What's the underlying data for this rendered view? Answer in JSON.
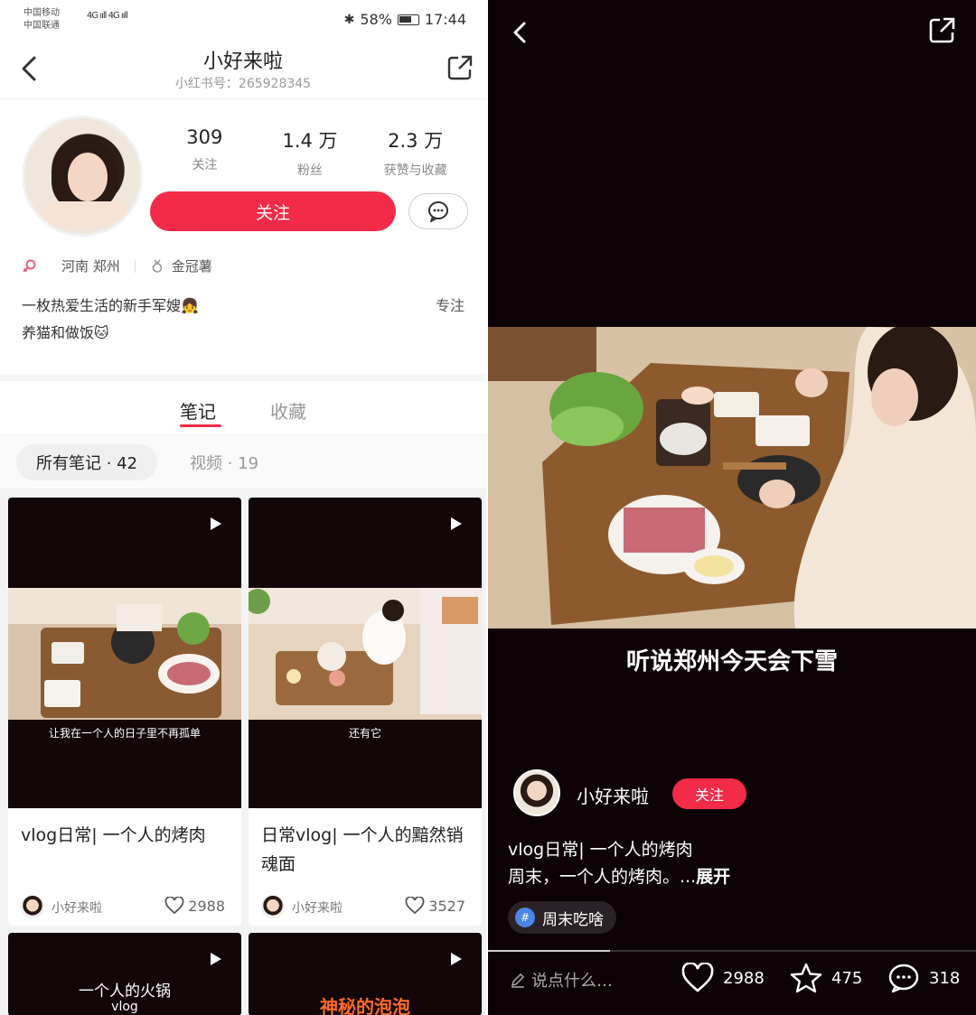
{
  "status_bar": {
    "carrier1": "中国移动",
    "carrier2": "中国联通",
    "signal": "4G ııll 4G ııll",
    "battery": "58%",
    "time": "17:44"
  },
  "profile_nav": {
    "title": "小好来啦",
    "subtitle": "小红书号：265928345"
  },
  "profile": {
    "stats": [
      {
        "value": "309",
        "label": "关注"
      },
      {
        "value": "1.4 万",
        "label": "粉丝"
      },
      {
        "value": "2.3 万",
        "label": "获赞与收藏"
      }
    ],
    "follow_label": "关注",
    "location": "河南 郑州",
    "badge": "金冠薯",
    "bio_line1": "一枚热爱生活的新手军嫂👧",
    "bio_line2": "养猫和做饭🐱",
    "focus": "专注"
  },
  "tabs": [
    {
      "label": "笔记",
      "active": true
    },
    {
      "label": "收藏",
      "active": false
    }
  ],
  "filters": {
    "all": "所有笔记 · 42",
    "video": "视频 · 19"
  },
  "notes": [
    {
      "subtitle": "让我在一个人的日子里不再孤单",
      "title": "vlog日常| 一个人的烤肉",
      "author": "小好来啦",
      "likes": "2988"
    },
    {
      "subtitle": "还有它",
      "title": "日常vlog| 一个人的黯然销魂面",
      "author": "小好来啦",
      "likes": "3527"
    },
    {
      "overlay": "一个人的火锅",
      "overlay_sub": "vlog"
    },
    {
      "overlay": "神秘的泡泡"
    }
  ],
  "video": {
    "caption": "听说郑州今天会下雪",
    "author": "小好来啦",
    "follow_label": "关注",
    "title": "vlog日常| 一个人的烤肉",
    "desc": "周末，一个人的烤肉。...",
    "expand": "展开",
    "tag": "周末吃啥",
    "progress": 0.25,
    "comment_placeholder": "说点什么…",
    "likes": "2988",
    "stars": "475",
    "comments": "318"
  },
  "colors": {
    "accent": "#f22b49",
    "video_bg": "#0d0205",
    "tag_icon": "#4a86e8"
  }
}
